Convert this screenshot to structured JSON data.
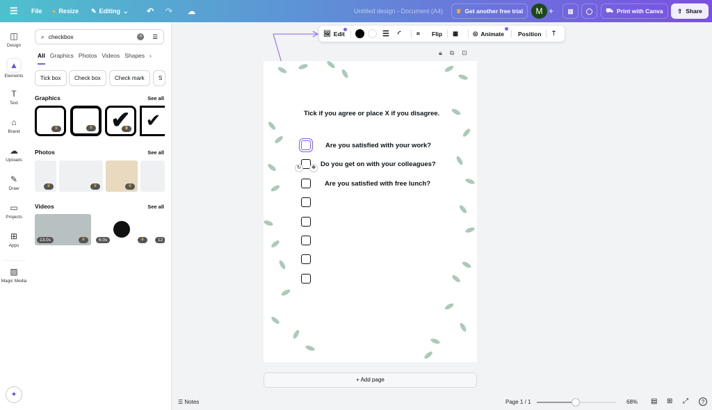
{
  "topbar": {
    "menu_icon": "hamburger-icon",
    "file": "File",
    "resize": "Resize",
    "editing": "Editing",
    "doc_title": "Untitled design - Document (A4)",
    "trial": "Get another free trial",
    "avatar": "M",
    "print": "Print with Canva",
    "share": "Share"
  },
  "rail": [
    {
      "label": "Design",
      "icon": "layout-icon"
    },
    {
      "label": "Elements",
      "icon": "shapes-icon"
    },
    {
      "label": "Text",
      "icon": "text-icon"
    },
    {
      "label": "Brand",
      "icon": "brand-icon"
    },
    {
      "label": "Uploads",
      "icon": "cloud-upload-icon"
    },
    {
      "label": "Draw",
      "icon": "pen-icon"
    },
    {
      "label": "Projects",
      "icon": "folder-icon"
    },
    {
      "label": "Apps",
      "icon": "apps-icon"
    },
    {
      "label": "Magic Media",
      "icon": "magic-media-icon"
    }
  ],
  "panel": {
    "search_value": "checkbox",
    "tabs": [
      "All",
      "Graphics",
      "Photos",
      "Videos",
      "Shapes"
    ],
    "chips": [
      "Tick box",
      "Check box",
      "Check mark",
      "S"
    ],
    "graphics": "Graphics",
    "photos": "Photos",
    "videos": "Videos",
    "see_all": "See all",
    "video_durations": [
      "13.0s",
      "6.0s",
      "12"
    ]
  },
  "toolbar": {
    "edit": "Edit",
    "flip": "Flip",
    "animate": "Animate",
    "position": "Position",
    "colors": [
      "#000000",
      "#ffffff"
    ]
  },
  "page": {
    "heading": "Tick if you agree or place X if you disagree.",
    "questions": [
      "Are you satisfied with your work?",
      "Do you get on with your colleagues?",
      "Are you satisfied with free lunch?"
    ]
  },
  "bottom": {
    "add_page": "+ Add page",
    "notes": "Notes",
    "page_indicator": "Page 1 / 1",
    "zoom": "68%",
    "zoom_slider_percent": 49
  },
  "accent": "#7d5cf0"
}
